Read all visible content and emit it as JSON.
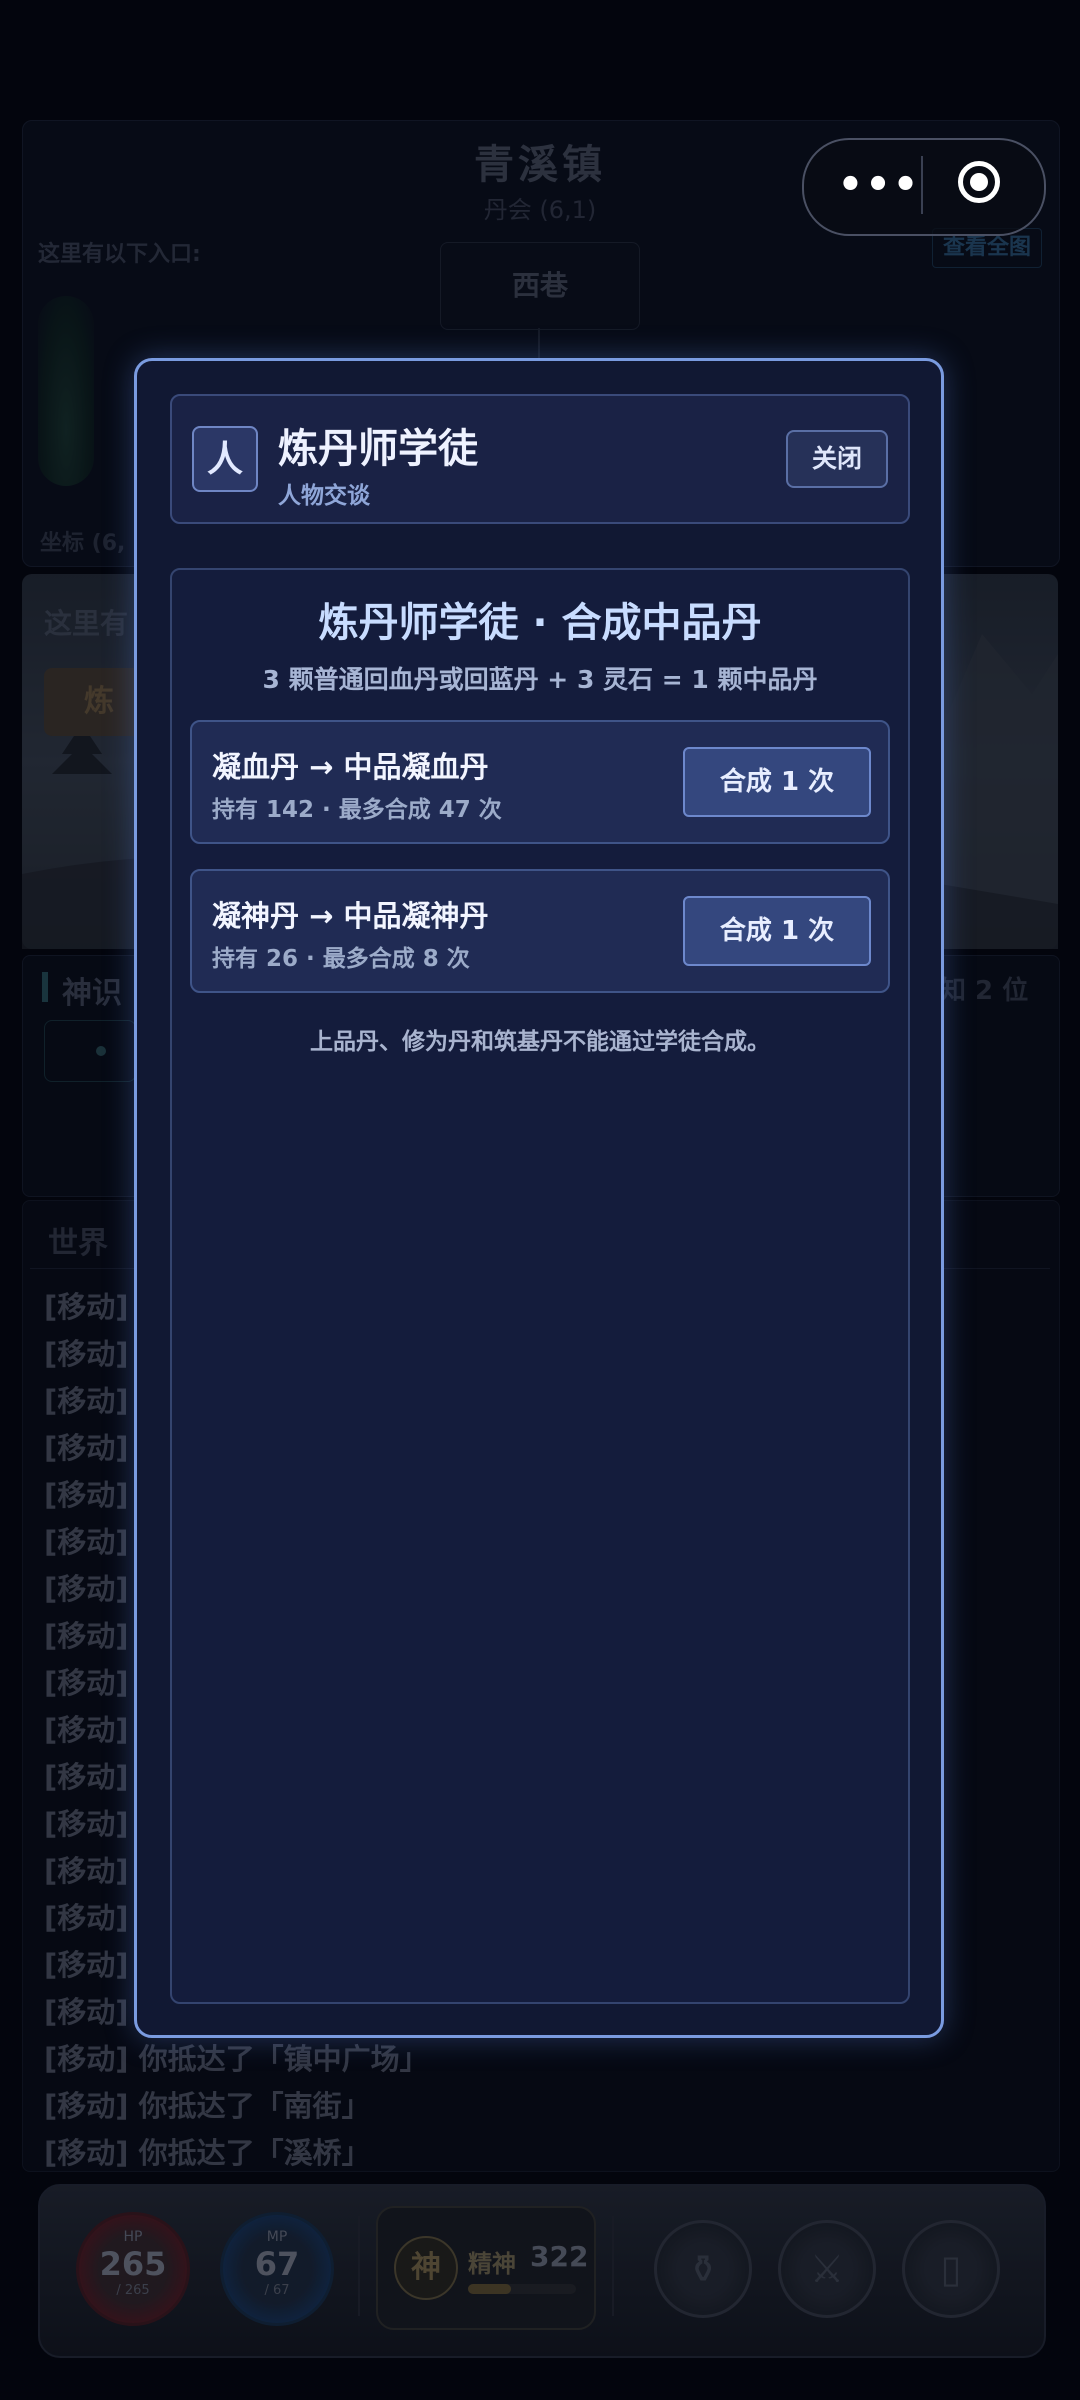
{
  "location": {
    "town": "青溪镇",
    "place": "丹会 (6,1)",
    "entries_label": "这里有以下入口:",
    "view_map": "查看全图",
    "node": "西巷",
    "coord": "坐标 (6,",
    "scene_text": "这里有",
    "scene_tag": "炼"
  },
  "sense": {
    "title": "神识",
    "right": "知 2 位"
  },
  "world": {
    "title": "世界",
    "logs": [
      "[移动]",
      "[移动]",
      "[移动]",
      "[移动]",
      "[移动]",
      "[移动]",
      "[移动]",
      "[移动]",
      "[移动]",
      "[移动]",
      "[移动]",
      "[移动]",
      "[移动]",
      "[移动]",
      "[移动]",
      "[移动]",
      "[移动] 你抵达了「镇中广场」",
      "[移动] 你抵达了「南街」",
      "[移动] 你抵达了「溪桥」"
    ]
  },
  "status": {
    "hp": {
      "label": "HP",
      "value": "265",
      "max": "/ 265"
    },
    "mp": {
      "label": "MP",
      "value": "67",
      "max": "/ 67"
    },
    "spirit": {
      "icon_text": "神",
      "label": "精神",
      "value": "322",
      "fill_fraction": 0.4
    }
  },
  "bottom_buttons": [
    "pot-icon",
    "crossed-swords-icon",
    "phone-icon"
  ],
  "capsule": {
    "menu_icon": "more-dots-icon",
    "close_icon": "target-circle-icon",
    "dots": "•••"
  },
  "dialog": {
    "avatar_text": "人",
    "npc_name": "炼丹师学徒",
    "subtitle": "人物交谈",
    "close_label": "关闭",
    "body_title": "炼丹师学徒 · 合成中品丹",
    "formula": "3 颗普通回血丹或回蓝丹 + 3 灵石 = 1 颗中品丹",
    "recipes": [
      {
        "name": "凝血丹 → 中品凝血丹",
        "info": "持有 142 · 最多合成 47 次",
        "button": "合成 1 次"
      },
      {
        "name": "凝神丹 → 中品凝神丹",
        "info": "持有 26 · 最多合成 8 次",
        "button": "合成 1 次"
      }
    ],
    "note": "上品丹、修为丹和筑基丹不能通过学徒合成。"
  },
  "colors": {
    "modal_border": "#7a9be0",
    "title_blue": "#c8dcff",
    "button_bg": "#34477e"
  }
}
